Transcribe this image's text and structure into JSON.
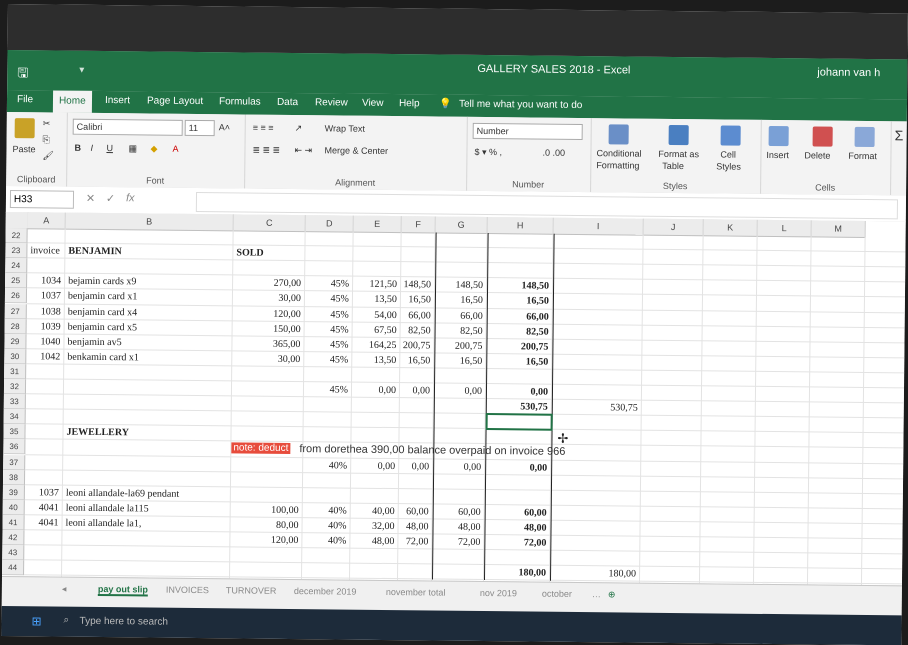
{
  "window": {
    "title": "GALLERY SALES 2018 - Excel",
    "user": "johann van h"
  },
  "tabs": [
    "File",
    "Home",
    "Insert",
    "Page Layout",
    "Formulas",
    "Data",
    "Review",
    "View",
    "Help"
  ],
  "tell_me": "Tell me what you want to do",
  "ribbon": {
    "paste": "Paste",
    "clipboard": "Clipboard",
    "font_name": "Calibri",
    "font_size": "11",
    "font_group": "Font",
    "wrap_text": "Wrap Text",
    "merge_center": "Merge & Center",
    "alignment": "Alignment",
    "number_format": "Number",
    "number_group": "Number",
    "conditional": "Conditional",
    "formatting": "Formatting",
    "format_as": "Format as",
    "table": "Table",
    "cell": "Cell",
    "styles_btn": "Styles",
    "styles_group": "Styles",
    "insert": "Insert",
    "delete": "Delete",
    "format": "Format",
    "cells_group": "Cells",
    "bold": "B",
    "italic": "I",
    "underline": "U"
  },
  "namebox": "H33",
  "fx": "fx",
  "columns": [
    "A",
    "B",
    "C",
    "D",
    "E",
    "F",
    "G",
    "H",
    "I",
    "J",
    "K",
    "L",
    "M"
  ],
  "rows": [
    "22",
    "23",
    "24",
    "25",
    "26",
    "27",
    "28",
    "29",
    "30",
    "31",
    "32",
    "33",
    "34",
    "35",
    "36",
    "37",
    "38",
    "39",
    "40",
    "41",
    "42",
    "43",
    "44"
  ],
  "cells": {
    "a23": "invoice",
    "b23": "BENJAMIN",
    "c23": "SOLD",
    "data_rows": [
      {
        "inv": "1034",
        "desc": "bejamin cards x9",
        "c": "270,00",
        "d": "45%",
        "e": "121,50",
        "f": "148,50",
        "g": "148,50",
        "h": "148,50"
      },
      {
        "inv": "1037",
        "desc": "benjamin card x1",
        "c": "30,00",
        "d": "45%",
        "e": "13,50",
        "f": "16,50",
        "g": "16,50",
        "h": "16,50"
      },
      {
        "inv": "1038",
        "desc": "benjamin card x4",
        "c": "120,00",
        "d": "45%",
        "e": "54,00",
        "f": "66,00",
        "g": "66,00",
        "h": "66,00"
      },
      {
        "inv": "1039",
        "desc": "benjamin card x5",
        "c": "150,00",
        "d": "45%",
        "e": "67,50",
        "f": "82,50",
        "g": "82,50",
        "h": "82,50"
      },
      {
        "inv": "1040",
        "desc": "benjamin av5",
        "c": "365,00",
        "d": "45%",
        "e": "164,25",
        "f": "200,75",
        "g": "200,75",
        "h": "200,75"
      },
      {
        "inv": "1042",
        "desc": "benkamin card x1",
        "c": "30,00",
        "d": "45%",
        "e": "13,50",
        "f": "16,50",
        "g": "16,50",
        "h": "16,50"
      }
    ],
    "r32": {
      "d": "45%",
      "e": "0,00",
      "f": "0,00",
      "g": "0,00",
      "h": "0,00"
    },
    "h33": "530,75",
    "i33": "530,75",
    "b35": "JEWELLERY",
    "note_label": "note: deduct",
    "note_text": "from dorethea 390,00 balance overpaid on invoice 966",
    "r37": {
      "d": "40%",
      "e": "0,00",
      "f": "0,00",
      "g": "0,00",
      "h": "0,00"
    },
    "jewel_rows": [
      {
        "inv": "1037",
        "desc": "leoni allandale-la69 pendant",
        "c": "",
        "d": "",
        "e": "",
        "f": "",
        "g": "",
        "h": ""
      },
      {
        "inv": "4041",
        "desc": "leoni allandale la115",
        "c": "100,00",
        "d": "40%",
        "e": "40,00",
        "f": "60,00",
        "g": "60,00",
        "h": "60,00"
      },
      {
        "inv": "4041",
        "desc": "leoni allandale la1,",
        "c": "80,00",
        "d": "40%",
        "e": "32,00",
        "f": "48,00",
        "g": "48,00",
        "h": "48,00"
      },
      {
        "inv": "",
        "desc": "",
        "c": "120,00",
        "d": "40%",
        "e": "48,00",
        "f": "72,00",
        "g": "72,00",
        "h": "72,00"
      }
    ],
    "h44": "180,00",
    "i44": "180,00"
  },
  "sheets": [
    "pay out slip",
    "INVOICES",
    "TURNOVER",
    "december 2019",
    "november total",
    "nov 2019",
    "october"
  ],
  "taskbar": {
    "search": "Type here to search"
  }
}
